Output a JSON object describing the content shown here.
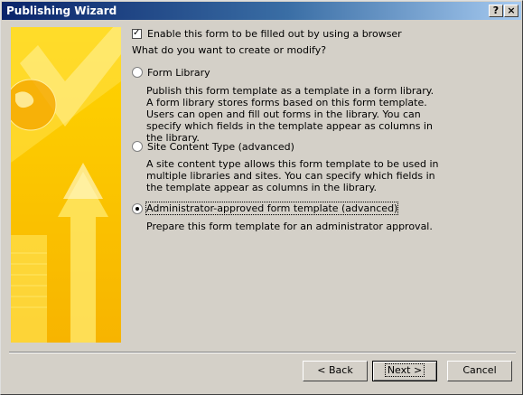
{
  "window": {
    "title": "Publishing Wizard",
    "help_glyph": "?",
    "close_glyph": "×"
  },
  "enable_browser": {
    "checked": true,
    "label": "Enable this form to be filled out by using a browser"
  },
  "question": "What do you want to create or modify?",
  "options": [
    {
      "label": "Form Library",
      "selected": false,
      "description": "Publish this form template as a template in a form library. A form library stores forms based on this form template. Users can open and fill out forms in the library. You can specify which fields in the template appear as columns in the library."
    },
    {
      "label": "Site Content Type (advanced)",
      "selected": false,
      "description": "A site content type allows this form template to be used in multiple libraries and sites. You can specify which fields in the template appear as columns in the library."
    },
    {
      "label": "Administrator-approved form template (advanced)",
      "selected": true,
      "description": "Prepare this form template for an administrator approval."
    }
  ],
  "buttons": {
    "back": "< Back",
    "next": "Next >",
    "cancel": "Cancel"
  }
}
